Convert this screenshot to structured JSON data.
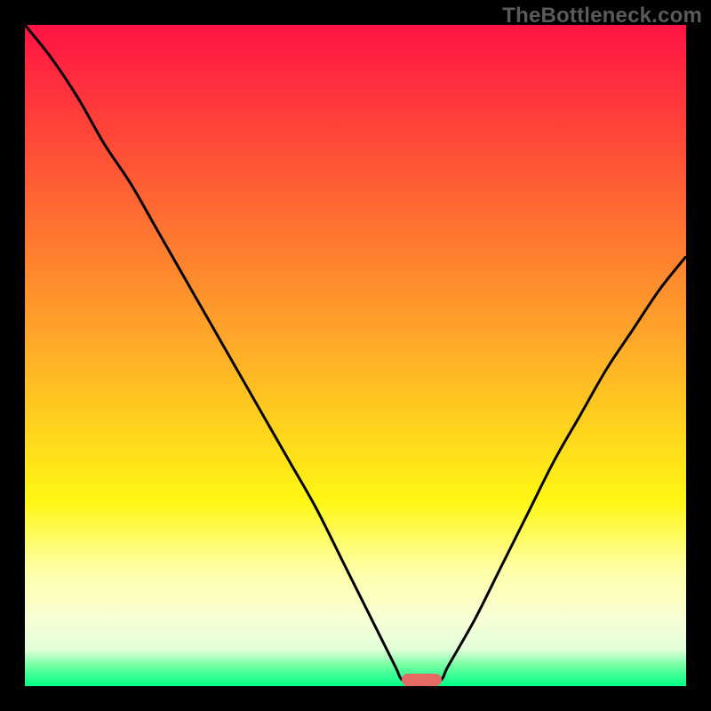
{
  "watermark": {
    "text": "TheBottleneck.com"
  },
  "colors": {
    "red_top": "#ff1344",
    "red_mid": "#ff4b37",
    "orange": "#ffa929",
    "yellow": "#fff714",
    "pale_yellow": "#ffffa3",
    "cream": "#f7ffd6",
    "near_white": "#e1ffd8",
    "green_light": "#6effa0",
    "green": "#00ff87",
    "curve": "#000000",
    "marker": "#e46a63",
    "frame": "#000000"
  },
  "chart_data": {
    "type": "line",
    "title": "",
    "xlabel": "",
    "ylabel": "",
    "xlim": [
      0,
      100
    ],
    "ylim": [
      0,
      100
    ],
    "grid": false,
    "legend": false,
    "x": [
      0,
      4,
      8,
      12,
      16,
      20,
      24,
      28,
      32,
      36,
      40,
      44,
      48,
      52,
      56,
      57,
      59,
      61,
      63,
      64,
      68,
      72,
      76,
      80,
      84,
      88,
      92,
      96,
      100
    ],
    "series": [
      {
        "name": "bottleneck-curve",
        "values": [
          100,
          95,
          89,
          82,
          76,
          69,
          62,
          55,
          48,
          41,
          34,
          27,
          19,
          11,
          3,
          1,
          0,
          0,
          1,
          3,
          10,
          18,
          26,
          34,
          41,
          48,
          54,
          60,
          65
        ]
      }
    ],
    "background_gradient_stops": [
      {
        "pos": 0.0,
        "color": "#ff1344"
      },
      {
        "pos": 0.18,
        "color": "#ff4b37"
      },
      {
        "pos": 0.48,
        "color": "#ffa929"
      },
      {
        "pos": 0.72,
        "color": "#fff714"
      },
      {
        "pos": 0.82,
        "color": "#ffffa3"
      },
      {
        "pos": 0.9,
        "color": "#f7ffd6"
      },
      {
        "pos": 0.945,
        "color": "#e1ffd8"
      },
      {
        "pos": 0.97,
        "color": "#6effa0"
      },
      {
        "pos": 1.0,
        "color": "#00ff87"
      }
    ],
    "marker": {
      "x_center": 60,
      "width_pct": 6,
      "y": 0
    }
  }
}
